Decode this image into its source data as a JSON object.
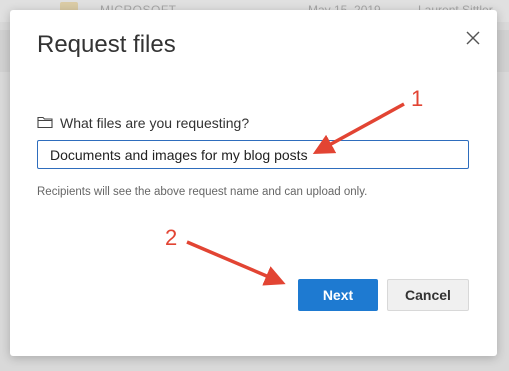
{
  "background": {
    "file_name": "MICROSOFT",
    "file_date": "May 15, 2019",
    "file_owner": "Laurent Sittler"
  },
  "dialog": {
    "title": "Request files",
    "close_icon": "close-icon",
    "question_icon": "folder-icon",
    "question_label": "What files are you requesting?",
    "request_name_value": "Documents and images for my blog posts",
    "help_text": "Recipients will see the above request name and can upload only.",
    "next_label": "Next",
    "cancel_label": "Cancel"
  },
  "annotations": {
    "step1": "1",
    "step2": "2",
    "color": "#e24433"
  },
  "colors": {
    "primary": "#1e7ad1",
    "input_border": "#2e6dbd"
  }
}
